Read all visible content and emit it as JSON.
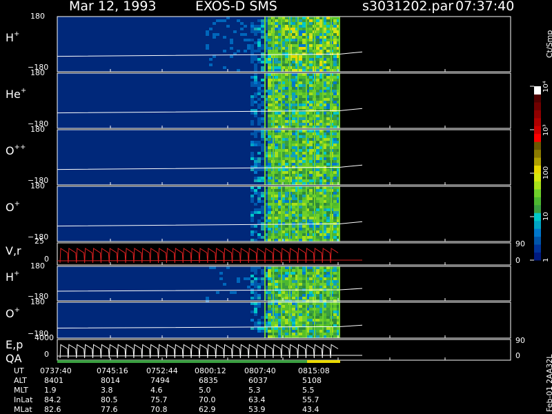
{
  "header": {
    "date": "Mar 12, 1993",
    "instrument": "EXOS-D SMS",
    "file": "s3031202.par",
    "time": "07:37:40"
  },
  "colorbar": {
    "title": "Ct/Smp",
    "ticks": [
      {
        "label": "1",
        "value": 1
      },
      {
        "label": "10",
        "value": 10
      },
      {
        "label": "100",
        "value": 100
      },
      {
        "label": "10³",
        "value": 1000
      },
      {
        "label": "10⁴",
        "value": 10000
      }
    ],
    "colors": [
      "#001a80",
      "#003399",
      "#0055aa",
      "#0077cc",
      "#00a3c4",
      "#00c8c8",
      "#3a9e40",
      "#4cb830",
      "#6fd02a",
      "#a8e01a",
      "#d6e810",
      "#e8d800",
      "#b0a000",
      "#8a7a00",
      "#6a5800",
      "#ff0000",
      "#d00000",
      "#b00000",
      "#900000",
      "#700000",
      "#500000",
      "#ffffff"
    ]
  },
  "chart_data": [
    {
      "type": "heatmap",
      "panel": "H+",
      "label": "H",
      "sup": "+",
      "ylabel_top": "180",
      "ylabel_bottom": "−180",
      "ylim": [
        -180,
        180
      ]
    },
    {
      "type": "heatmap",
      "panel": "He+",
      "label": "He",
      "sup": "+",
      "ylabel_top": "180",
      "ylabel_bottom": "−180",
      "ylim": [
        -180,
        180
      ]
    },
    {
      "type": "heatmap",
      "panel": "O++",
      "label": "O",
      "sup": "++",
      "ylabel_top": "180",
      "ylabel_bottom": "−180",
      "ylim": [
        -180,
        180
      ]
    },
    {
      "type": "heatmap",
      "panel": "O+",
      "label": "O",
      "sup": "+",
      "ylabel_top": "180",
      "ylabel_bottom": "−180",
      "ylim": [
        -180,
        180
      ]
    },
    {
      "type": "line",
      "panel": "V,r",
      "label": "V,r",
      "ylabel_top": "25",
      "ylabel_bottom": "0",
      "right_top": "90",
      "right_bottom": "0",
      "ylim": [
        0,
        25
      ]
    },
    {
      "type": "heatmap",
      "panel": "H+ (2)",
      "label": "H",
      "sup": "+",
      "ylabel_top": "180",
      "ylabel_bottom": "−180",
      "ylim": [
        -180,
        180
      ]
    },
    {
      "type": "heatmap",
      "panel": "O+ (2)",
      "label": "O",
      "sup": "+",
      "ylabel_top": "180",
      "ylabel_bottom": "−180",
      "ylim": [
        -180,
        180
      ]
    },
    {
      "type": "line",
      "panel": "E,p",
      "label": "E,p",
      "ylabel_top": "4000",
      "ylabel_bottom": "0",
      "right_top": "90",
      "right_bottom": "0",
      "ylim": [
        0,
        4000
      ]
    }
  ],
  "qa_label": "QA",
  "ephemeris": {
    "rows": [
      {
        "name": "UT",
        "values": [
          "0737:40",
          "0745:16",
          "0752:44",
          "0800:12",
          "0807:40",
          "0815:08"
        ]
      },
      {
        "name": "ALT",
        "values": [
          "8401",
          "8014",
          "7494",
          "6835",
          "6037",
          "5108"
        ]
      },
      {
        "name": "MLT",
        "values": [
          "1.9",
          "3.8",
          "4.6",
          "5.0",
          "5.3",
          "5.5"
        ]
      },
      {
        "name": "InLat",
        "values": [
          "84.2",
          "80.5",
          "75.7",
          "70.0",
          "63.4",
          "55.7"
        ]
      },
      {
        "name": "MLat",
        "values": [
          "82.6",
          "77.6",
          "70.8",
          "62.9",
          "53.9",
          "43.4"
        ]
      }
    ]
  },
  "footer_label": "Feb-01 2AA32L"
}
